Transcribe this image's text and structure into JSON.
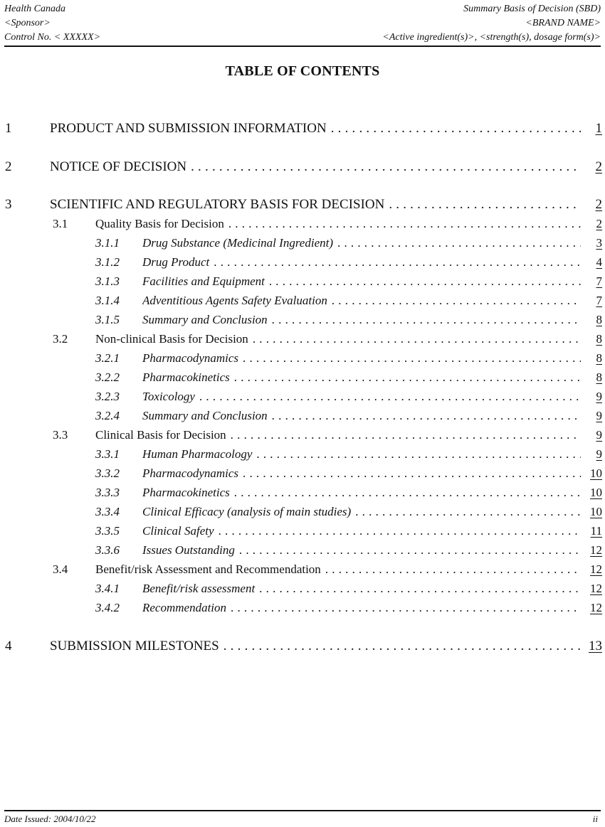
{
  "header": {
    "left": [
      "Health Canada",
      "<Sponsor>",
      "Control No. < XXXXX>"
    ],
    "right": [
      "Summary Basis of Decision (SBD)",
      "<BRAND NAME>",
      "<Active ingredient(s)>, <strength(s), dosage form(s)>"
    ]
  },
  "title": "TABLE OF CONTENTS",
  "toc": [
    {
      "level": 1,
      "number": "1",
      "label": "PRODUCT AND SUBMISSION INFORMATION",
      "page": "1"
    },
    {
      "level": 1,
      "number": "2",
      "label": "NOTICE OF DECISION",
      "page": "2"
    },
    {
      "level": 1,
      "number": "3",
      "label": "SCIENTIFIC AND REGULATORY BASIS FOR DECISION",
      "page": "2"
    },
    {
      "level": 2,
      "number": "3.1",
      "label": "Quality Basis for Decision",
      "page": "2"
    },
    {
      "level": 3,
      "number": "3.1.1",
      "label": "Drug Substance (Medicinal Ingredient)",
      "page": "3"
    },
    {
      "level": 3,
      "number": "3.1.2",
      "label": "Drug Product",
      "page": "4"
    },
    {
      "level": 3,
      "number": "3.1.3",
      "label": "Facilities and Equipment",
      "page": "7"
    },
    {
      "level": 3,
      "number": "3.1.4",
      "label": "Adventitious Agents Safety Evaluation",
      "page": "7"
    },
    {
      "level": 3,
      "number": "3.1.5",
      "label": "Summary and Conclusion",
      "page": "8"
    },
    {
      "level": 2,
      "number": "3.2",
      "label": "Non-clinical Basis for Decision",
      "page": "8"
    },
    {
      "level": 3,
      "number": "3.2.1",
      "label": "Pharmacodynamics",
      "page": "8"
    },
    {
      "level": 3,
      "number": "3.2.2",
      "label": "Pharmacokinetics",
      "page": "8"
    },
    {
      "level": 3,
      "number": "3.2.3",
      "label": "Toxicology",
      "page": "9"
    },
    {
      "level": 3,
      "number": "3.2.4",
      "label": "Summary and Conclusion",
      "page": "9"
    },
    {
      "level": 2,
      "number": "3.3",
      "label": "Clinical Basis for Decision",
      "page": "9"
    },
    {
      "level": 3,
      "number": "3.3.1",
      "label": "Human Pharmacology",
      "page": "9"
    },
    {
      "level": 3,
      "number": "3.3.2",
      "label": "Pharmacodynamics",
      "page": "10"
    },
    {
      "level": 3,
      "number": "3.3.3",
      "label": "Pharmacokinetics",
      "page": "10"
    },
    {
      "level": 3,
      "number": "3.3.4",
      "label": "Clinical Efficacy (analysis of main studies)",
      "page": "10"
    },
    {
      "level": 3,
      "number": "3.3.5",
      "label": "Clinical Safety",
      "page": "11"
    },
    {
      "level": 3,
      "number": "3.3.6",
      "label": "Issues Outstanding",
      "page": "12"
    },
    {
      "level": 2,
      "number": "3.4",
      "label": "Benefit/risk Assessment and Recommendation",
      "page": "12"
    },
    {
      "level": 3,
      "number": "3.4.1",
      "label": "Benefit/risk assessment",
      "page": "12"
    },
    {
      "level": 3,
      "number": "3.4.2",
      "label": "Recommendation",
      "page": "12"
    },
    {
      "level": 1,
      "number": "4",
      "label": "SUBMISSION MILESTONES",
      "page": "13"
    }
  ],
  "footer": {
    "date_issued": "Date Issued: 2004/10/22",
    "page_number": "ii"
  }
}
